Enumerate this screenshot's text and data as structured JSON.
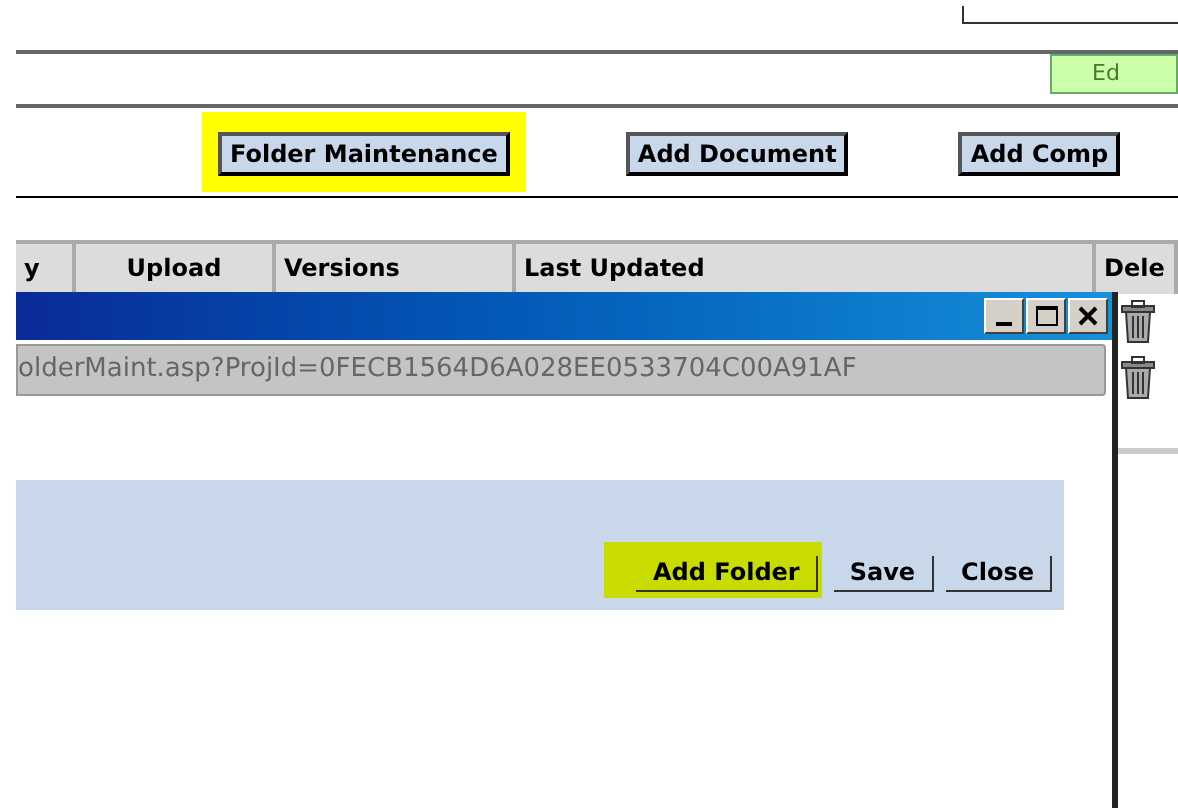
{
  "page": {
    "status_badge": "Ed",
    "toolbar_buttons": [
      {
        "label": "Folder Maintenance",
        "highlighted": true
      },
      {
        "label": "Add Document",
        "highlighted": false
      },
      {
        "label": "Add Comp",
        "highlighted": false
      }
    ]
  },
  "table": {
    "columns": [
      "y",
      "Upload",
      "Versions",
      "Last Updated",
      "Dele"
    ]
  },
  "popup": {
    "address": "olderMaint.asp?ProjId=0FECB1564D6A028EE0533704C00A91AF",
    "buttons": [
      {
        "label": "Add Folder",
        "highlighted": true
      },
      {
        "label": "Save",
        "highlighted": false
      },
      {
        "label": "Close",
        "highlighted": false
      }
    ]
  }
}
